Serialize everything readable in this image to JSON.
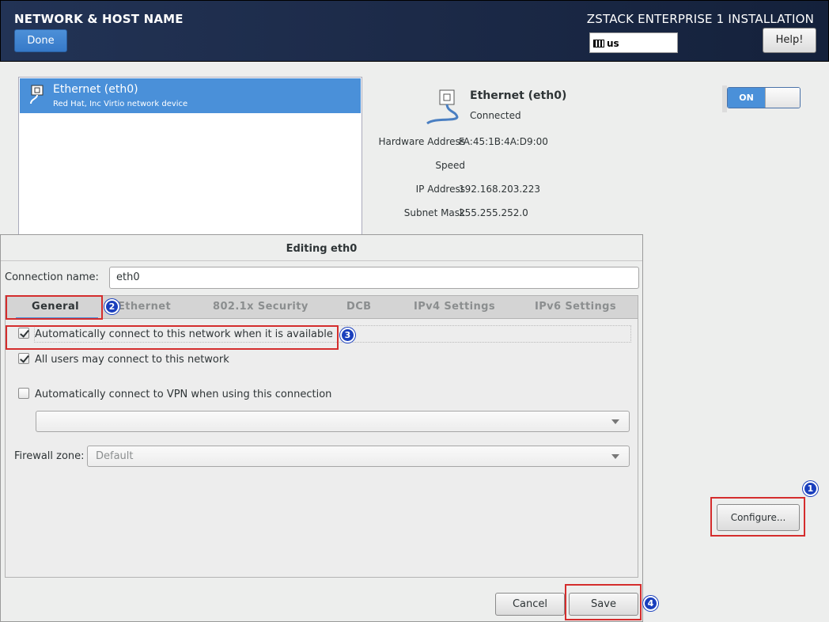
{
  "header": {
    "title": "NETWORK & HOST NAME",
    "done_label": "Done",
    "product": "ZSTACK ENTERPRISE 1 INSTALLATION",
    "keyboard_layout": "us",
    "help_label": "Help!"
  },
  "device_list": {
    "items": [
      {
        "name": "Ethernet (eth0)",
        "description": "Red Hat, Inc Virtio network device"
      }
    ]
  },
  "details": {
    "name": "Ethernet (eth0)",
    "status": "Connected",
    "rows": [
      {
        "label": "Hardware Address",
        "value": "FA:45:1B:4A:D9:00"
      },
      {
        "label": "Speed",
        "value": ""
      },
      {
        "label": "IP Address",
        "value": "192.168.203.223"
      },
      {
        "label": "Subnet Mask",
        "value": "255.255.252.0"
      }
    ],
    "toggle_label": "ON",
    "configure_label": "Configure..."
  },
  "dialog": {
    "title": "Editing eth0",
    "connection_name_label": "Connection name:",
    "connection_name_value": "eth0",
    "tabs": [
      "General",
      "Ethernet",
      "802.1x Security",
      "DCB",
      "IPv4 Settings",
      "IPv6 Settings"
    ],
    "active_tab": "General",
    "general": {
      "auto_connect_label": "Automatically connect to this network when it is available",
      "auto_connect_checked": true,
      "all_users_label": "All users may connect to this network",
      "all_users_checked": true,
      "vpn_label": "Automatically connect to VPN when using this connection",
      "vpn_checked": false,
      "vpn_select_value": "",
      "firewall_label": "Firewall zone:",
      "firewall_value": "Default"
    },
    "cancel_label": "Cancel",
    "save_label": "Save"
  },
  "annotations": {
    "badges": [
      "1",
      "2",
      "3",
      "4"
    ],
    "colors": {
      "highlight": "#d42d2d",
      "badge": "#1a3fbd",
      "accent": "#4a90d9"
    }
  }
}
